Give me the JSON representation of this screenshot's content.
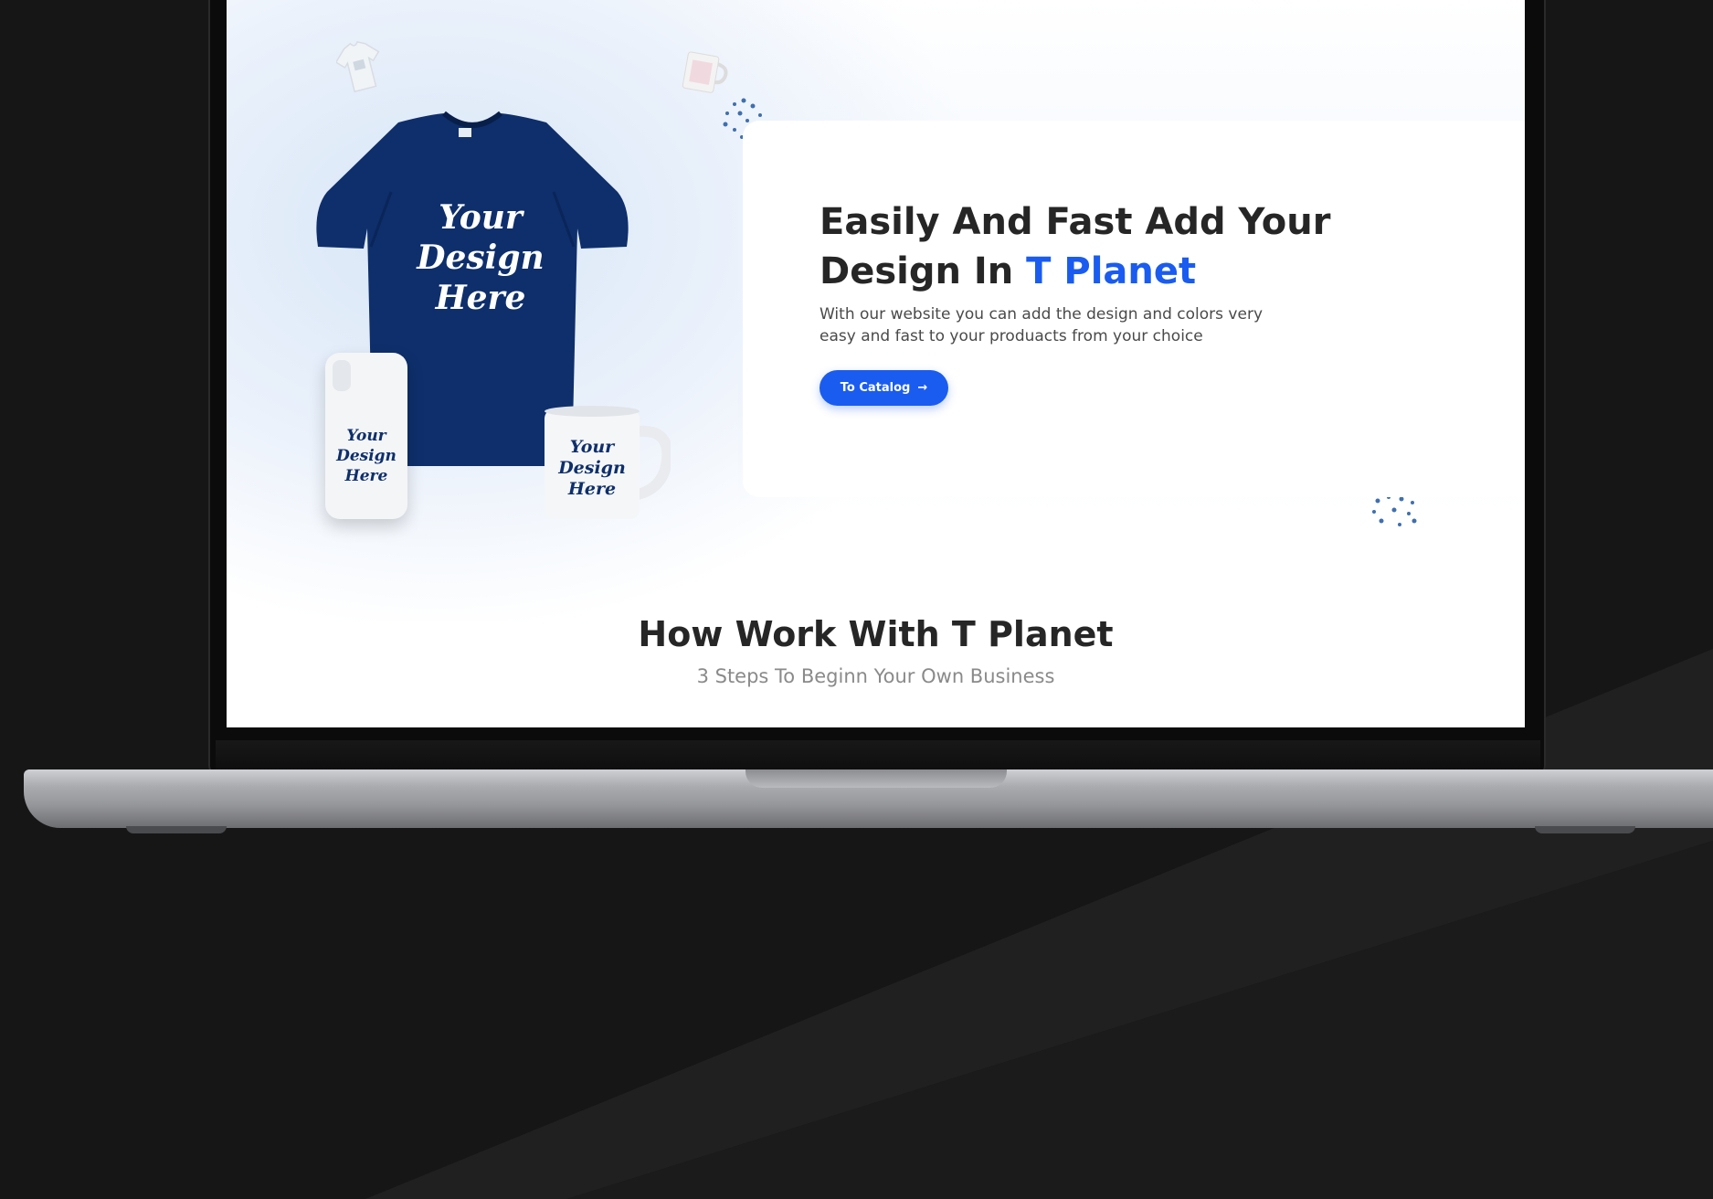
{
  "hero": {
    "title_part1": "Easily And Fast Add Your Design In ",
    "title_brand": "T Planet",
    "description": "With our website you can add the design and colors very easy and fast to your produacts from your choice",
    "cta_label": "To Catalog",
    "cta_icon": "arrow-right-icon"
  },
  "mockups": {
    "shirt_text": [
      "Your",
      "Design",
      "Here"
    ],
    "phone_text": [
      "Your",
      "Design",
      "Here"
    ],
    "mug_text": [
      "Your",
      "Design",
      "Here"
    ]
  },
  "section": {
    "title": "How Work With T Planet",
    "subtitle": "3 Steps To Beginn Your Own Business"
  },
  "colors": {
    "accent": "#1a5cf0",
    "shirt": "#0e2f6b",
    "heading": "#262626",
    "background": "#161616"
  }
}
